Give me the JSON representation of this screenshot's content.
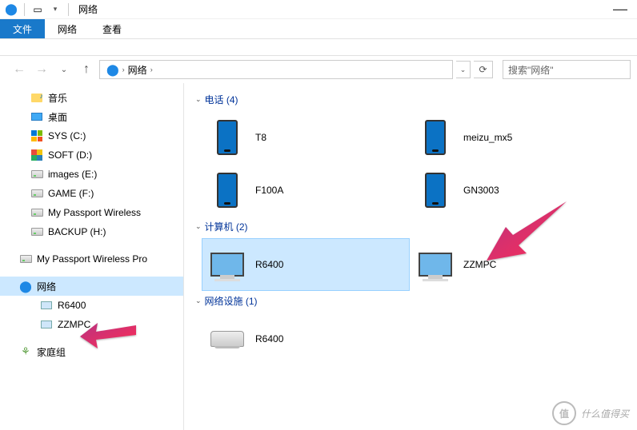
{
  "window": {
    "title": "网络",
    "minimize": "—"
  },
  "qat": {
    "dropdown": "▾"
  },
  "ribbon": {
    "file": "文件",
    "tabs": [
      "网络",
      "查看"
    ]
  },
  "nav_buttons": {
    "back": "←",
    "forward": "→",
    "up": "↑",
    "history": "⌄"
  },
  "address": {
    "location": "网络",
    "crumb_sep": "›",
    "refresh": "⟳",
    "dropdown": "⌄"
  },
  "search": {
    "placeholder": "搜索\"网络\""
  },
  "tree": [
    {
      "label": "音乐",
      "icon": "music-folder",
      "depth": 1
    },
    {
      "label": "桌面",
      "icon": "desktop",
      "depth": 1
    },
    {
      "label": "SYS (C:)",
      "icon": "sys",
      "depth": 1
    },
    {
      "label": "SOFT (D:)",
      "icon": "soft",
      "depth": 1
    },
    {
      "label": "images (E:)",
      "icon": "drive",
      "depth": 1
    },
    {
      "label": "GAME (F:)",
      "icon": "drive",
      "depth": 1
    },
    {
      "label": "My Passport Wireless",
      "icon": "drive",
      "depth": 1
    },
    {
      "label": "BACKUP (H:)",
      "icon": "drive",
      "depth": 1
    },
    {
      "label": "My Passport Wireless Pro",
      "icon": "drive",
      "depth": 0
    },
    {
      "label": "网络",
      "icon": "network",
      "depth": 0,
      "selected": true
    },
    {
      "label": "R6400",
      "icon": "computer",
      "depth": 1
    },
    {
      "label": "ZZMPC",
      "icon": "computer",
      "depth": 1
    },
    {
      "label": "家庭组",
      "icon": "homegroup",
      "depth": 0
    }
  ],
  "groups": [
    {
      "name": "电话",
      "count": 4,
      "items": [
        {
          "name": "T8",
          "kind": "phone"
        },
        {
          "name": "meizu_mx5",
          "kind": "phone"
        },
        {
          "name": "F100A",
          "kind": "phone"
        },
        {
          "name": "GN3003",
          "kind": "phone"
        }
      ]
    },
    {
      "name": "计算机",
      "count": 2,
      "items": [
        {
          "name": "R6400",
          "kind": "monitor",
          "selected": true
        },
        {
          "name": "ZZMPC",
          "kind": "monitor"
        }
      ]
    },
    {
      "name": "网络设施",
      "count": 1,
      "items": [
        {
          "name": "R6400",
          "kind": "router"
        }
      ]
    }
  ],
  "watermark": {
    "symbol": "值",
    "text": "什么值得买"
  }
}
